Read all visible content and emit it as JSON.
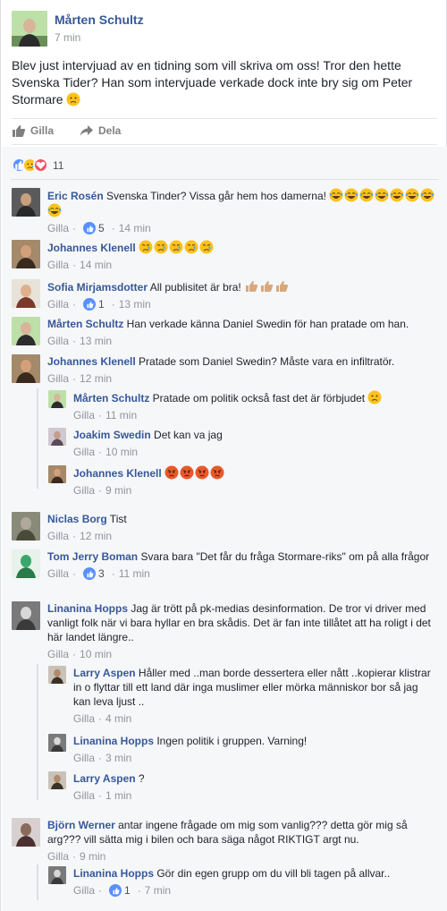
{
  "post": {
    "author": "Mårten Schultz",
    "time": "7 min",
    "text": "Blev just intervjuad av en tidning som vill skriva om oss! Tror den hette Svenska Tider? Han som intervjuade verkade dock inte bry sig om Peter Stormare",
    "text_emoji": "worried"
  },
  "actions": {
    "like_label": "Gilla",
    "share_label": "Dela"
  },
  "reactions": {
    "types": [
      "like-icon",
      "sad-icon",
      "love-icon"
    ],
    "count": "11"
  },
  "comments": [
    {
      "name": "Eric Rosén",
      "text": "Svenska Tinder? Vissa går hem hos damerna!",
      "emoji": "laugh",
      "emoji_count": 8,
      "like_label": "Gilla",
      "likes": "5",
      "time": "14 min"
    },
    {
      "name": "Johannes Klenell",
      "text": "",
      "emoji": "cry",
      "emoji_count": 5,
      "like_label": "Gilla",
      "likes": "",
      "time": "14 min"
    },
    {
      "name": "Sofia Mirjamsdotter",
      "text": "All publisitet är bra!",
      "emoji": "thumb",
      "emoji_count": 3,
      "like_label": "Gilla",
      "likes": "1",
      "time": "13 min"
    },
    {
      "name": "Mårten Schultz",
      "text": "Han verkade känna Daniel Swedin för han pratade om han.",
      "emoji": "",
      "emoji_count": 0,
      "like_label": "Gilla",
      "likes": "",
      "time": "13 min"
    },
    {
      "name": "Johannes Klenell",
      "text": "Pratade som Daniel Swedin? Måste vara en infiltratör.",
      "emoji": "",
      "emoji_count": 0,
      "like_label": "Gilla",
      "likes": "",
      "time": "12 min"
    },
    {
      "name": "Mårten Schultz",
      "text": "Pratade om politik också fast det är förbjudet",
      "emoji": "worried",
      "emoji_count": 1,
      "like_label": "Gilla",
      "likes": "",
      "time": "11 min",
      "reply": true
    },
    {
      "name": "Joakim Swedin",
      "text": "Det kan va jag",
      "emoji": "",
      "emoji_count": 0,
      "like_label": "Gilla",
      "likes": "",
      "time": "10 min",
      "reply": true
    },
    {
      "name": "Johannes Klenell",
      "text": "",
      "emoji": "angry",
      "emoji_count": 4,
      "like_label": "Gilla",
      "likes": "",
      "time": "9 min",
      "reply": true
    },
    {
      "name": "Niclas Borg",
      "text": "Tist",
      "emoji": "",
      "emoji_count": 0,
      "like_label": "Gilla",
      "likes": "",
      "time": "12 min"
    },
    {
      "name": "Tom Jerry Boman",
      "text": "Svara bara \"Det får du fråga Stormare-riks\" om på alla frågor",
      "emoji": "",
      "emoji_count": 0,
      "like_label": "Gilla",
      "likes": "3",
      "time": "11 min"
    },
    {
      "name": "Linanina Hopps",
      "text": "Jag är trött på pk-medias desinformation. De tror vi driver med vanligt folk när vi bara hyllar en bra skådis. Det är fan inte tillåtet att ha roligt i det här landet längre..",
      "emoji": "",
      "emoji_count": 0,
      "like_label": "Gilla",
      "likes": "",
      "time": "10 min"
    },
    {
      "name": "Larry Aspen",
      "text": "Håller med ..man borde dessertera eller nått ..kopierar klistrar in o flyttar till ett land där inga muslimer eller mörka människor bor så jag kan leva ljust ..",
      "emoji": "",
      "emoji_count": 0,
      "like_label": "Gilla",
      "likes": "",
      "time": "4 min",
      "reply": true
    },
    {
      "name": "Linanina Hopps",
      "text": "Ingen politik i gruppen. Varning!",
      "emoji": "",
      "emoji_count": 0,
      "like_label": "Gilla",
      "likes": "",
      "time": "3 min",
      "reply": true
    },
    {
      "name": "Larry Aspen",
      "text": "?",
      "emoji": "",
      "emoji_count": 0,
      "like_label": "Gilla",
      "likes": "",
      "time": "1 min",
      "reply": true
    },
    {
      "name": "Björn Werner",
      "text": "antar ingene frågade om mig som vanlig??? detta gör mig så arg??? vill sätta mig i bilen och bara säga något RIKTIGT argt nu.",
      "emoji": "",
      "emoji_count": 0,
      "like_label": "Gilla",
      "likes": "",
      "time": "9 min"
    },
    {
      "name": "Linanina Hopps",
      "text": "Gör din egen grupp om du vill bli tagen på allvar..",
      "emoji": "",
      "emoji_count": 0,
      "like_label": "Gilla",
      "likes": "1",
      "time": "7 min",
      "reply": true
    }
  ],
  "colors": {
    "link": "#365899",
    "meta": "#90949c",
    "comments_bg": "#f6f7f9",
    "like_blue": "#5890ff",
    "love_red": "#f25268",
    "emoji_yellow": "#fcc21b"
  }
}
